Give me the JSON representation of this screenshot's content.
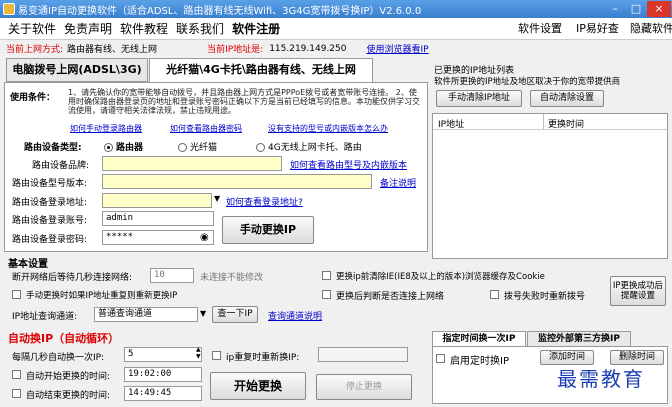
{
  "window": {
    "title": "易变通IP自动更换软件（适合ADSL、路由器有线无线Wifi、3G4G宽带拨号换IP）V2.6.0.0",
    "min": "–",
    "max": "□",
    "close": "×"
  },
  "menu": {
    "about": "关于软件",
    "disclaimer": "免责声明",
    "tutorial": "软件教程",
    "contact": "联系我们",
    "register": "软件注册",
    "settings": "软件设置",
    "ipgood": "IP易好查",
    "hide": "隐藏软件"
  },
  "info": {
    "mode_label": "当前上网方式:",
    "mode_value": "路由器有线、无线上网",
    "ip_label": "当前IP地址是:",
    "ip_value": "115.219.149.250",
    "browser_link": "使用浏览器看IP"
  },
  "tabs": {
    "dial": "电脑拨号上网(ADSL\\3G)",
    "router": "光纤猫\\4G卡托\\路由器有线、无线上网"
  },
  "usage": {
    "label": "使用条件：",
    "text": "1、请先确认你的宽带能够自动拨号，并且路由器上网方式是PPPoE拨号或者宽带账号连接。 2、使用时确保路由器登录页的地址和登录账号密码正确以下方是当前已经填写的信息。本功能仅供学习交流使用，请遵守相关法律法规，禁止违规用途。",
    "link1": "如何手动登录路由器",
    "link2": "如何查看路由器密码",
    "link3": "没有支持的型号或内嵌版本怎么办"
  },
  "router": {
    "type_label": "路由设备类型:",
    "opt_router": "路由器",
    "opt_fiber": "光纤猫",
    "opt_4g": "4G无线上网卡托、路由",
    "brand_label": "路由设备品牌:",
    "brand_link": "如何查看路由型号及内嵌版本",
    "model_label": "路由设备型号版本:",
    "model_link": "备注说明",
    "addr_label": "路由设备登录地址:",
    "addr_link": "如何查看登录地址?",
    "account_label": "路由设备登录账号:",
    "account_value": "admin",
    "password_label": "路由设备登录密码:",
    "password_value": "*****",
    "manual_button": "手动更换IP"
  },
  "history": {
    "title": "已更换的IP地址列表",
    "desc": "软件所更换的IP地址及地区取决于你的宽带提供商",
    "clear_manual": "手动清除IP地址",
    "clear_auto": "自动清除设置",
    "col_ip": "IP地址",
    "col_time": "更换时间"
  },
  "basic": {
    "title": "基本设置",
    "reconnect_label": "断开网络后等待几秒连接网络:",
    "reconnect_value": "10",
    "reconnect_hint": "未连接不能修改",
    "ie_clear": "更换ip前清除IE(IE8及以上的版本)浏览器缓存及Cookie",
    "manual_dup": "手动更换时如果IP地址重复则重新更换IP",
    "check_net": "更换后判断是否连接上网络",
    "dial_fail": "拨号失败时重新拨号",
    "channel_label": "IP地址查询通道:",
    "channel_value": "普通查询通道",
    "next_button": "查一下IP",
    "channel_link": "查询通道说明",
    "right_button": "IP更换成功后提醒设置"
  },
  "auto": {
    "title": "自动换IP（自动循环）",
    "interval_label": "每隔几秒自动换一次IP:",
    "interval_value": "5",
    "dup_label": "ip重复时重新换IP:",
    "start_time_label": "自动开始更换的时间:",
    "start_time_value": "19:02:00",
    "end_time_label": "自动结束更换的时间:",
    "end_time_value": "14:49:45",
    "start_button": "开始更换",
    "stop_button": "停止更换"
  },
  "schedule": {
    "tab1": "指定时间换一次IP",
    "tab2": "监控外部第三方换IP",
    "enable": "启用定时换IP",
    "add": "添加时间",
    "delete": "删除时间"
  },
  "watermark": "最需教育"
}
